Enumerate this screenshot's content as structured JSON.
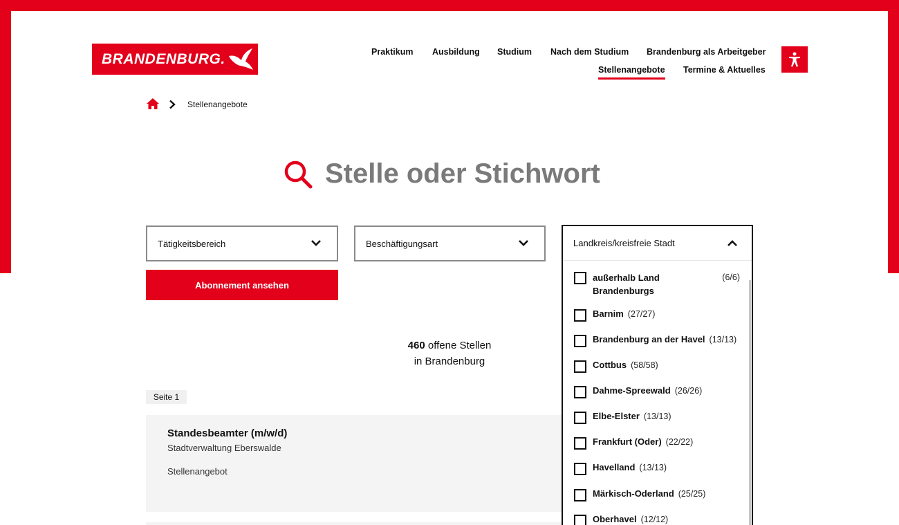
{
  "brand": {
    "logo_text": "BRANDENBURG.",
    "color": "#e2001a"
  },
  "nav": {
    "items": [
      {
        "label": "Praktikum"
      },
      {
        "label": "Ausbildung"
      },
      {
        "label": "Studium"
      },
      {
        "label": "Nach dem Studium"
      },
      {
        "label": "Brandenburg als Arbeitgeber"
      },
      {
        "label": "Stellenangebote",
        "active": true
      },
      {
        "label": "Termine & Aktuelles"
      }
    ],
    "accessibility_icon": "accessibility-icon"
  },
  "breadcrumb": {
    "home_icon": "home-icon",
    "separator_icon": "chevron-right-icon",
    "current": "Stellenangebote"
  },
  "search": {
    "placeholder": "Stelle oder Stichwort",
    "icon": "search-icon"
  },
  "filters": {
    "taetigkeitsbereich": "Tätigkeitsbereich",
    "beschaeftigungsart": "Beschäftigungsart",
    "landkreis": "Landkreis/kreisfreie Stadt"
  },
  "subscribe_button": "Abonnement ansehen",
  "results": {
    "count": "460",
    "count_suffix": "offene Stellen",
    "location_line": "in Brandenburg",
    "page_label": "Seite 1"
  },
  "jobs": [
    {
      "title": "Standesbeamter (m/w/d)",
      "employer": "Stadtverwaltung Eberswalde",
      "type": "Stellenangebot"
    }
  ],
  "landkreis_options": [
    {
      "label": "außerhalb Land Brandenburgs",
      "count": "(6/6)"
    },
    {
      "label": "Barnim",
      "count": "(27/27)"
    },
    {
      "label": "Brandenburg an der Havel",
      "count": "(13/13)"
    },
    {
      "label": "Cottbus",
      "count": "(58/58)"
    },
    {
      "label": "Dahme-Spreewald",
      "count": "(26/26)"
    },
    {
      "label": "Elbe-Elster",
      "count": "(13/13)"
    },
    {
      "label": "Frankfurt (Oder)",
      "count": "(22/22)"
    },
    {
      "label": "Havelland",
      "count": "(13/13)"
    },
    {
      "label": "Märkisch-Oderland",
      "count": "(25/25)"
    },
    {
      "label": "Oberhavel",
      "count": "(12/12)"
    }
  ]
}
